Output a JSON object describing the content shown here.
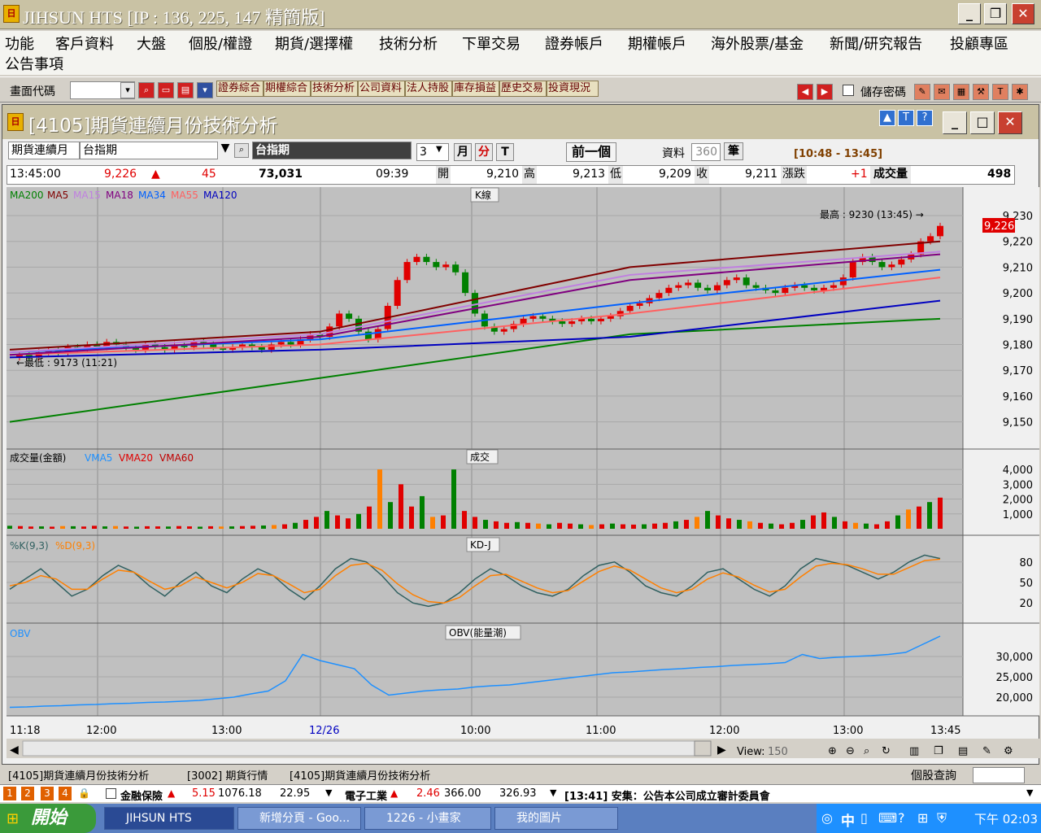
{
  "window": {
    "title": "JIHSUN HTS      [IP : 136, 225, 147 精簡版]",
    "logo": "日"
  },
  "menu": [
    "功能",
    "客戶資料",
    "大盤",
    "個股/權證",
    "期貨/選擇權",
    "技術分析",
    "下單交易",
    "證券帳戶",
    "期權帳戶",
    "海外股票/基金",
    "新聞/研究報告",
    "投顧專區",
    "公告事項"
  ],
  "toolbar": {
    "code_label": "畫面代碼",
    "code_value": "",
    "quick_buttons": [
      "證券綜合",
      "期權綜合",
      "技術分析",
      "公司資料",
      "法人持股",
      "庫存損益",
      "歷史交易",
      "投資現況"
    ],
    "save_pw_label": "儲存密碼"
  },
  "inner": {
    "title": "[4105]期貨連續月份技術分析",
    "contract_type": "期貨連續月",
    "product": "台指期",
    "product_name": "台指期",
    "period_value": "3",
    "period_unit_month": "月",
    "period_unit_min": "分",
    "period_unit_tick": "T",
    "prev_button": "前一個",
    "data_label": "資料",
    "data_count": "360",
    "data_unit": "筆",
    "time_range": "[10:48 - 13:45]"
  },
  "quote": {
    "time": "13:45:00",
    "price": "9,226",
    "change": "45",
    "volume_total": "73,031",
    "bar_time": "09:39",
    "open_label": "開",
    "open": "9,210",
    "high_label": "高",
    "high": "9,213",
    "low_label": "低",
    "low": "9,209",
    "close_label": "收",
    "close": "9,211",
    "diff_label": "漲跌",
    "diff": "+1",
    "vol_label": "成交量",
    "vol": "498"
  },
  "chart_data": [
    {
      "type": "line",
      "title": "K線",
      "legend": [
        "MA200",
        "MA5",
        "MA15",
        "MA18",
        "MA34",
        "MA55",
        "MA120"
      ],
      "legend_colors": [
        "#008000",
        "#800000",
        "#c080e0",
        "#800080",
        "#0060ff",
        "#ff6060",
        "#0000c0"
      ],
      "x_ticks": [
        "11:18",
        "12:00",
        "13:00",
        "12/26",
        "10:00",
        "11:00",
        "12:00",
        "13:00",
        "13:45"
      ],
      "y_ticks": [
        9230,
        9220,
        9210,
        9200,
        9190,
        9180,
        9170,
        9160,
        9150
      ],
      "ylim": [
        9142,
        9236
      ],
      "annotation_high": "最高 : 9230 (13:45) →",
      "annotation_low": "←最低 : 9173 (11:21)",
      "last_price_label": "9,226",
      "close_series": [
        9175,
        9176,
        9175,
        9177,
        9178,
        9177,
        9179,
        9178,
        9180,
        9179,
        9181,
        9180,
        9179,
        9178,
        9180,
        9179,
        9178,
        9180,
        9179,
        9181,
        9180,
        9179,
        9178,
        9179,
        9180,
        9179,
        9178,
        9180,
        9181,
        9180,
        9182,
        9184,
        9183,
        9187,
        9192,
        9190,
        9185,
        9182,
        9186,
        9195,
        9205,
        9212,
        9214,
        9212,
        9210,
        9211,
        9208,
        9200,
        9192,
        9187,
        9185,
        9186,
        9188,
        9190,
        9191,
        9190,
        9189,
        9188,
        9189,
        9190,
        9189,
        9190,
        9191,
        9193,
        9195,
        9196,
        9198,
        9200,
        9202,
        9203,
        9204,
        9202,
        9201,
        9203,
        9205,
        9206,
        9203,
        9202,
        9201,
        9200,
        9202,
        9203,
        9202,
        9201,
        9202,
        9203,
        9206,
        9212,
        9214,
        9212,
        9210,
        9211,
        9213,
        9215,
        9220,
        9222,
        9226
      ],
      "ma200": [
        9150,
        9167,
        9184,
        9190
      ],
      "ma120": [
        9175,
        9178,
        9183,
        9197
      ],
      "ma55": [
        9176,
        9180,
        9192,
        9206
      ],
      "ma34": [
        9177,
        9182,
        9196,
        9209
      ],
      "ma18": [
        9176,
        9183,
        9205,
        9215
      ],
      "ma15": [
        9177,
        9184,
        9207,
        9216
      ],
      "ma5": [
        9178,
        9185,
        9210,
        9220
      ]
    },
    {
      "type": "bar",
      "title": "成交",
      "legend": [
        "成交量(金額)",
        "VMA5",
        "VMA20",
        "VMA60"
      ],
      "legend_colors": [
        "#000000",
        "#1e90ff",
        "#e00000",
        "#c00000"
      ],
      "y_ticks": [
        4000,
        3000,
        2000,
        1000
      ],
      "ylim": [
        0,
        4500
      ],
      "values": [
        200,
        180,
        150,
        160,
        140,
        180,
        170,
        150,
        200,
        160,
        180,
        150,
        140,
        170,
        160,
        150,
        180,
        160,
        140,
        170,
        150,
        160,
        180,
        200,
        220,
        250,
        300,
        400,
        600,
        800,
        1200,
        900,
        700,
        1000,
        1500,
        4000,
        1800,
        3000,
        1500,
        2200,
        800,
        900,
        4000,
        1200,
        800,
        600,
        500,
        400,
        450,
        400,
        350,
        300,
        400,
        350,
        300,
        250,
        300,
        350,
        300,
        280,
        300,
        350,
        400,
        500,
        600,
        800,
        1200,
        900,
        700,
        600,
        500,
        400,
        350,
        300,
        400,
        600,
        900,
        1100,
        800,
        500,
        400,
        350,
        300,
        500,
        900,
        1300,
        1500,
        1800,
        2100
      ]
    },
    {
      "type": "line",
      "title": "KD-J",
      "legend": [
        "%K(9,3)",
        "%D(9,3)"
      ],
      "legend_colors": [
        "#306060",
        "#ff8000"
      ],
      "y_ticks": [
        80,
        50,
        20
      ],
      "ylim": [
        0,
        100
      ],
      "k": [
        40,
        55,
        70,
        50,
        30,
        40,
        60,
        75,
        65,
        45,
        30,
        50,
        65,
        45,
        35,
        55,
        70,
        60,
        40,
        25,
        45,
        70,
        85,
        80,
        60,
        35,
        20,
        15,
        20,
        35,
        55,
        70,
        60,
        45,
        35,
        30,
        40,
        60,
        75,
        80,
        65,
        45,
        35,
        30,
        45,
        65,
        70,
        55,
        40,
        30,
        45,
        70,
        85,
        80,
        75,
        65,
        55,
        65,
        80,
        90,
        85
      ],
      "d": [
        45,
        50,
        60,
        55,
        40,
        40,
        55,
        68,
        65,
        52,
        40,
        45,
        58,
        50,
        42,
        50,
        63,
        60,
        48,
        35,
        40,
        60,
        75,
        78,
        68,
        48,
        32,
        22,
        20,
        28,
        45,
        60,
        62,
        52,
        42,
        35,
        38,
        52,
        66,
        74,
        68,
        55,
        42,
        35,
        40,
        55,
        64,
        58,
        46,
        36,
        40,
        58,
        74,
        78,
        76,
        70,
        62,
        62,
        72,
        82,
        84
      ]
    },
    {
      "type": "line",
      "title": "OBV(能量潮)",
      "legend": [
        "OBV"
      ],
      "legend_colors": [
        "#1e90ff"
      ],
      "y_ticks": [
        30000,
        25000,
        20000
      ],
      "ylim": [
        17000,
        35000
      ],
      "values": [
        17500,
        17600,
        17800,
        17900,
        18100,
        18200,
        18400,
        18500,
        18700,
        18800,
        19000,
        19200,
        19600,
        20000,
        20800,
        21500,
        24000,
        30500,
        29000,
        28000,
        27000,
        23000,
        20500,
        21000,
        21500,
        21800,
        22000,
        22500,
        22800,
        23000,
        23500,
        24000,
        24500,
        25000,
        25500,
        26000,
        26200,
        26500,
        26800,
        27000,
        27300,
        27500,
        27800,
        28000,
        28200,
        28500,
        30500,
        29500,
        29800,
        30000,
        30200,
        30500,
        31000,
        33000,
        35000
      ]
    }
  ],
  "chart_footer": {
    "view_label": "View:",
    "view_value": "150"
  },
  "tabs": [
    "[4105]期貨連續月份技術分析",
    "[3002] 期貨行情",
    "[4105]期貨連續月份技術分析"
  ],
  "stock_query_label": "個股查詢",
  "ticker": {
    "pages": [
      "1",
      "2",
      "3",
      "4"
    ],
    "item1_name": "金融保險",
    "item1_change": "5.15",
    "item1_index": "1076.18",
    "item1_vol": "22.95",
    "item2_name": "電子工業",
    "item2_change": "2.46",
    "item2_index": "366.00",
    "item2_vol": "326.93",
    "news": "[13:41] 安集：公告本公司成立審計委員會"
  },
  "taskbar": {
    "start": "開始",
    "items": [
      "JIHSUN HTS",
      "新增分頁 - Goo...",
      "1226 - 小畫家",
      "我的圖片"
    ],
    "ime": "中",
    "clock": "下午 02:03"
  }
}
